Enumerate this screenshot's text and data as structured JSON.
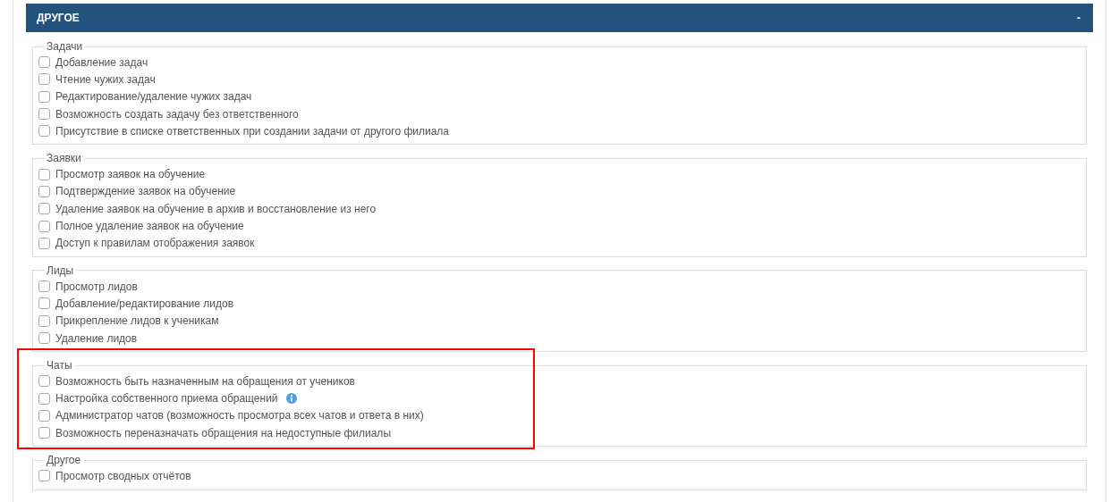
{
  "panel": {
    "title": "ДРУГОЕ",
    "collapse_symbol": "-"
  },
  "groups": [
    {
      "title": "Задачи",
      "highlighted": false,
      "items": [
        {
          "label": "Добавление задач",
          "checked": false,
          "info": false
        },
        {
          "label": "Чтение чужих задач",
          "checked": false,
          "info": false
        },
        {
          "label": "Редактирование/удаление чужих задач",
          "checked": false,
          "info": false
        },
        {
          "label": "Возможность создать задачу без ответственного",
          "checked": false,
          "info": false
        },
        {
          "label": "Присутствие в списке ответственных при создании задачи от другого филиала",
          "checked": false,
          "info": false
        }
      ]
    },
    {
      "title": "Заявки",
      "highlighted": false,
      "items": [
        {
          "label": "Просмотр заявок на обучение",
          "checked": false,
          "info": false
        },
        {
          "label": "Подтверждение заявок на обучение",
          "checked": false,
          "info": false
        },
        {
          "label": "Удаление заявок на обучение в архив и восстановление из него",
          "checked": false,
          "info": false
        },
        {
          "label": "Полное удаление заявок на обучение",
          "checked": false,
          "info": false
        },
        {
          "label": "Доступ к правилам отображения заявок",
          "checked": false,
          "info": false
        }
      ]
    },
    {
      "title": "Лиды",
      "highlighted": false,
      "items": [
        {
          "label": "Просмотр лидов",
          "checked": false,
          "info": false
        },
        {
          "label": "Добавление/редактирование лидов",
          "checked": false,
          "info": false
        },
        {
          "label": "Прикрепление лидов к ученикам",
          "checked": false,
          "info": false
        },
        {
          "label": "Удаление лидов",
          "checked": false,
          "info": false
        }
      ]
    },
    {
      "title": "Чаты",
      "highlighted": true,
      "items": [
        {
          "label": "Возможность быть назначенным на обращения от учеников",
          "checked": false,
          "info": false
        },
        {
          "label": "Настройка собственного приема обращений",
          "checked": false,
          "info": true
        },
        {
          "label": "Администратор чатов (возможность просмотра всех чатов и ответа в них)",
          "checked": false,
          "info": false
        },
        {
          "label": "Возможность переназначать обращения на недоступные филиалы",
          "checked": false,
          "info": false
        }
      ]
    },
    {
      "title": "Другое",
      "highlighted": false,
      "items": [
        {
          "label": "Просмотр сводных отчётов",
          "checked": false,
          "info": false
        }
      ]
    }
  ]
}
